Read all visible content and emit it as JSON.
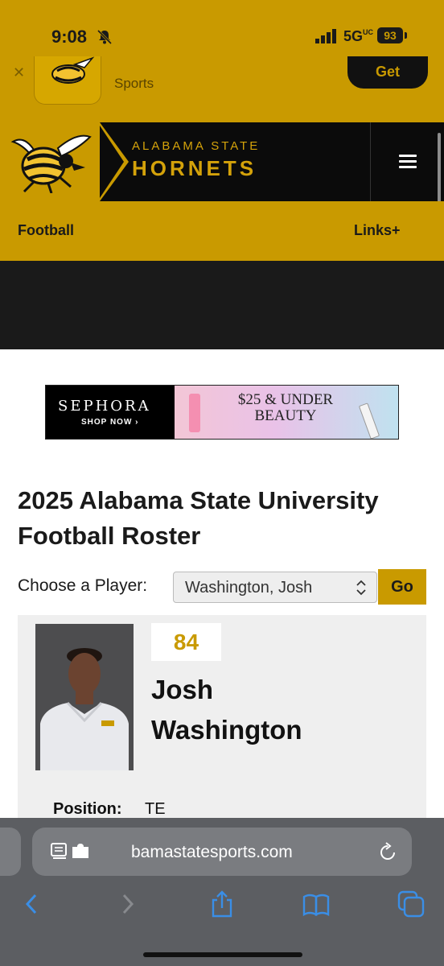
{
  "status_bar": {
    "time": "9:08",
    "network": "5G",
    "network_suffix": "UC",
    "battery": "93"
  },
  "app_banner": {
    "subtitle": "Sports",
    "get_label": "Get"
  },
  "header": {
    "brand_line1": "ALABAMA STATE",
    "brand_line2": "HORNETS"
  },
  "nav": {
    "sport": "Football",
    "links": "Links+"
  },
  "ad": {
    "brand": "SEPHORA",
    "cta": "SHOP NOW ›",
    "headline": "$25 & UNDER BEAUTY"
  },
  "roster": {
    "title": "2025 Alabama State University Football Roster",
    "choose_label": "Choose a Player:",
    "selected_player": "Washington, Josh",
    "go_label": "Go"
  },
  "player": {
    "number": "84",
    "first_name": "Josh",
    "last_name": "Washington",
    "position_label": "Position:",
    "position_value": "TE"
  },
  "browser": {
    "url": "bamastatesports.com"
  },
  "colors": {
    "gold": "#c99a00",
    "black": "#0b0b0b",
    "toolbar": "#5c5e62",
    "accent": "#3a8ee6"
  }
}
